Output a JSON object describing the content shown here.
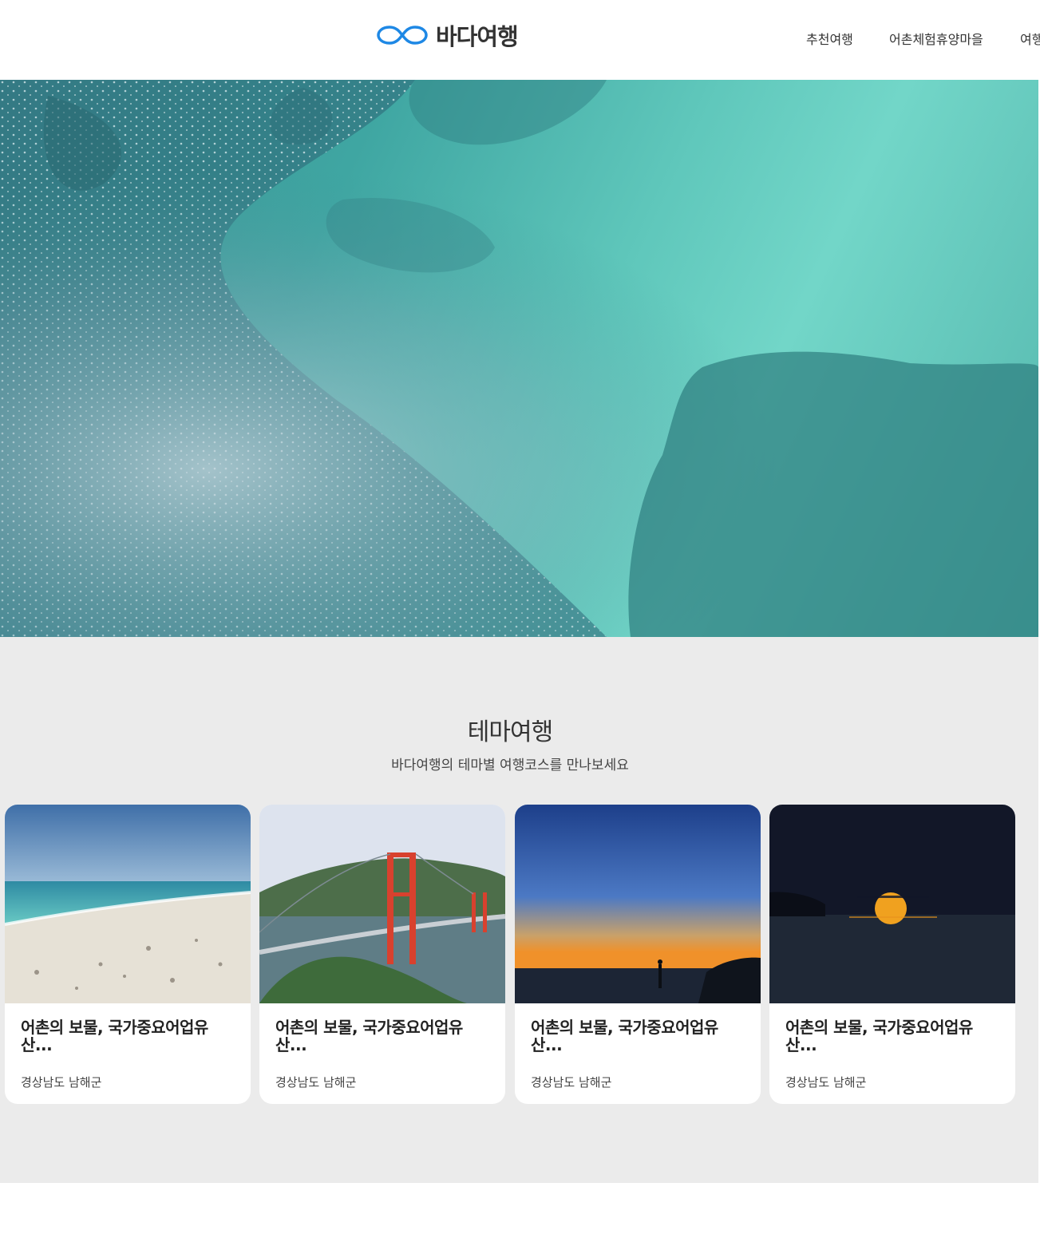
{
  "header": {
    "logo_text": "바다여행",
    "nav": [
      {
        "label": "추천여행"
      },
      {
        "label": "어촌체험휴양마을"
      },
      {
        "label": "여행"
      }
    ]
  },
  "theme": {
    "title": "테마여행",
    "subtitle": "바다여행의 테마별 여행코스를 만나보세요",
    "cards": [
      {
        "title": "어촌의 보물, 국가중요어업유산...",
        "location": "경상남도 남해군"
      },
      {
        "title": "어촌의 보물, 국가중요어업유산...",
        "location": "경상남도 남해군"
      },
      {
        "title": "어촌의 보물, 국가중요어업유산...",
        "location": "경상남도 남해군"
      },
      {
        "title": "어촌의 보물, 국가중요어업유산...",
        "location": "경상남도 남해군"
      }
    ]
  },
  "colors": {
    "brand_blue": "#1e88e5",
    "section_bg": "#ebebeb"
  }
}
